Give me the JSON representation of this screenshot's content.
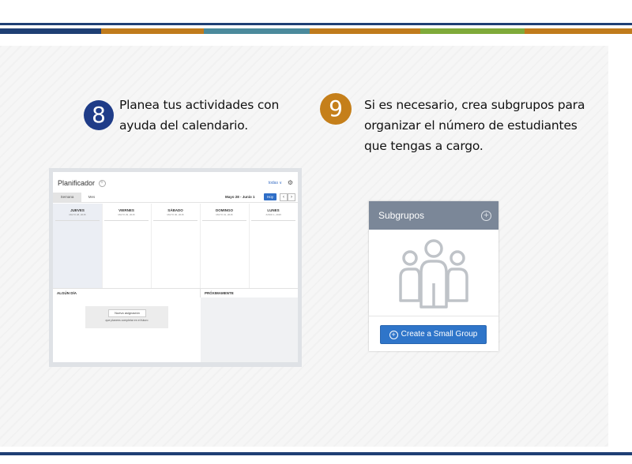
{
  "decor": {
    "top_line_color": "#1f3f74",
    "bar_segments": [
      {
        "color": "#1f3f74",
        "weight": 128
      },
      {
        "color": "#c07b1c",
        "weight": 130
      },
      {
        "color": "#4b8a9c",
        "weight": 134
      },
      {
        "color": "#c07b1c",
        "weight": 140
      },
      {
        "color": "#7faa3a",
        "weight": 132
      },
      {
        "color": "#c07b1c",
        "weight": 136
      }
    ]
  },
  "step8": {
    "number": "8",
    "color": "#1f3c88",
    "line1": "Planea tus actividades con",
    "line2": "ayuda del calendario."
  },
  "step9": {
    "number": "9",
    "color": "#c57f1a",
    "line1": "Si es necesario, crea subgrupos para",
    "line2": "organizar el número de estudiantes",
    "line3": "que tengas a cargo."
  },
  "planner": {
    "title": "Planificador",
    "todos_label": "todas ∨",
    "tabs": [
      "Semana",
      "Mes"
    ],
    "date_range": "Mayo 28 - Junio 1",
    "today_button": "Hoy",
    "days": [
      {
        "name": "JUEVES",
        "date": "MAYO 28, 2015"
      },
      {
        "name": "VIERNES",
        "date": "MAYO 29, 2015"
      },
      {
        "name": "SÁBADO",
        "date": "MAYO 30, 2015"
      },
      {
        "name": "DOMINGO",
        "date": "MAYO 31, 2015"
      },
      {
        "name": "LUNES",
        "date": "JUNIO 1, 2015"
      }
    ],
    "someday_label": "ALGÚN DÍA",
    "upcoming_label": "PRÓXIMAMENTE",
    "new_assignment_button": "Nueva asignación",
    "empty_text": "que planees completar en el futuro"
  },
  "subgroups": {
    "title": "Subgrupos",
    "header_color": "#7b8798",
    "button_label": "Create a Small Group",
    "button_color": "#2f75c9",
    "icon": "people-group-icon"
  }
}
